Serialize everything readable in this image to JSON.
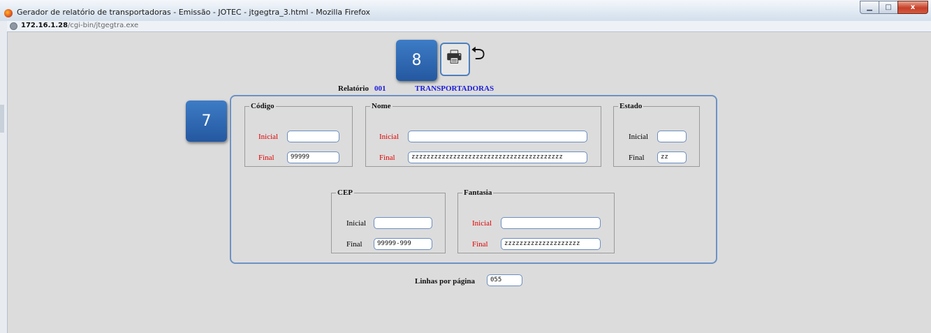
{
  "window": {
    "title": "Gerador de relatório de transportadoras - Emissão - JOTEC - jtgegtra_3.html - Mozilla Firefox",
    "controls": {
      "minimize": "▁",
      "maximize": "□",
      "close": "x"
    }
  },
  "address": {
    "host": "172.16.1.28",
    "path": "/cgi-bin/jtgegtra.exe"
  },
  "callouts": {
    "step8": "8",
    "step7": "7"
  },
  "toolbar": {
    "print_icon": "printer-icon",
    "print_glyph": "🖶",
    "back_icon": "back-arrow-icon",
    "back_glyph": "⮌"
  },
  "report": {
    "label": "Relatório",
    "code": "001",
    "name": "TRANSPORTADORAS"
  },
  "groups": {
    "codigo": {
      "title": "Código",
      "inicial_label": "Inicial",
      "final_label": "Final",
      "inicial": "",
      "final": "99999"
    },
    "nome": {
      "title": "Nome",
      "inicial_label": "Inicial",
      "final_label": "Final",
      "inicial": "",
      "final": "zzzzzzzzzzzzzzzzzzzzzzzzzzzzzzzzzzzzzzzz"
    },
    "estado": {
      "title": "Estado",
      "inicial_label": "Inicial",
      "final_label": "Final",
      "inicial": "",
      "final": "zz"
    },
    "cep": {
      "title": "CEP",
      "inicial_label": "Inicial",
      "final_label": "Final",
      "inicial": "",
      "final": "99999-999"
    },
    "fantasia": {
      "title": "Fantasia",
      "inicial_label": "Inicial",
      "final_label": "Final",
      "inicial": "",
      "final": "zzzzzzzzzzzzzzzzzzzz"
    }
  },
  "lines_per_page": {
    "label": "Linhas por página",
    "value": "055"
  },
  "colors": {
    "accent_border": "#6c92c4",
    "label_red": "#e00000",
    "label_blue": "#1b1bdc",
    "callout_blue": "#2d66b0"
  }
}
